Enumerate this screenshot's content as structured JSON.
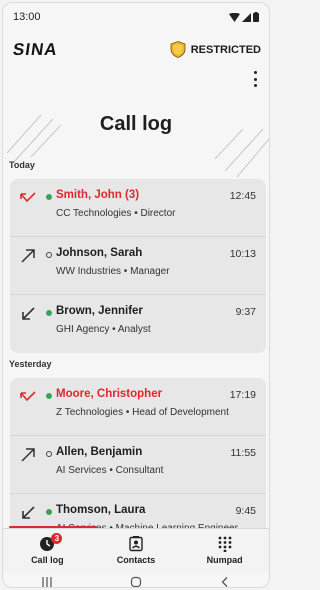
{
  "status_bar": {
    "time": "13:00"
  },
  "header": {
    "logo": "SINA",
    "classification": "RESTRICTED"
  },
  "page": {
    "title": "Call log"
  },
  "sections": [
    {
      "label": "Today",
      "calls": [
        {
          "name": "Smith, John (3)",
          "detail": "CC Technologies • Director",
          "time": "12:45",
          "direction": "missed",
          "status": "available"
        },
        {
          "name": "Johnson, Sarah",
          "detail": "WW Industries • Manager",
          "time": "10:13",
          "direction": "outgoing",
          "status": "offline"
        },
        {
          "name": "Brown, Jennifer",
          "detail": "GHI Agency • Analyst",
          "time": "9:37",
          "direction": "incoming",
          "status": "available"
        }
      ]
    },
    {
      "label": "Yesterday",
      "calls": [
        {
          "name": "Moore, Christopher",
          "detail": "Z Technologies • Head of Development",
          "time": "17:19",
          "direction": "missed",
          "status": "available"
        },
        {
          "name": "Allen, Benjamin",
          "detail": "AI Services • Consultant",
          "time": "11:55",
          "direction": "outgoing",
          "status": "offline"
        },
        {
          "name": "Thomson, Laura",
          "detail": "AI Services • Machine Learning Engineer",
          "time": "9:45",
          "direction": "incoming",
          "status": "available"
        }
      ]
    }
  ],
  "bottom_nav": {
    "items": [
      {
        "label": "Call log",
        "icon": "call-log-icon",
        "badge": "3",
        "active": true
      },
      {
        "label": "Contacts",
        "icon": "contacts-icon"
      },
      {
        "label": "Numpad",
        "icon": "numpad-icon"
      }
    ]
  },
  "colors": {
    "accent": "#d72a33",
    "missed": "#e2262e",
    "available": "#3aa357",
    "shield": "#f2b229"
  }
}
